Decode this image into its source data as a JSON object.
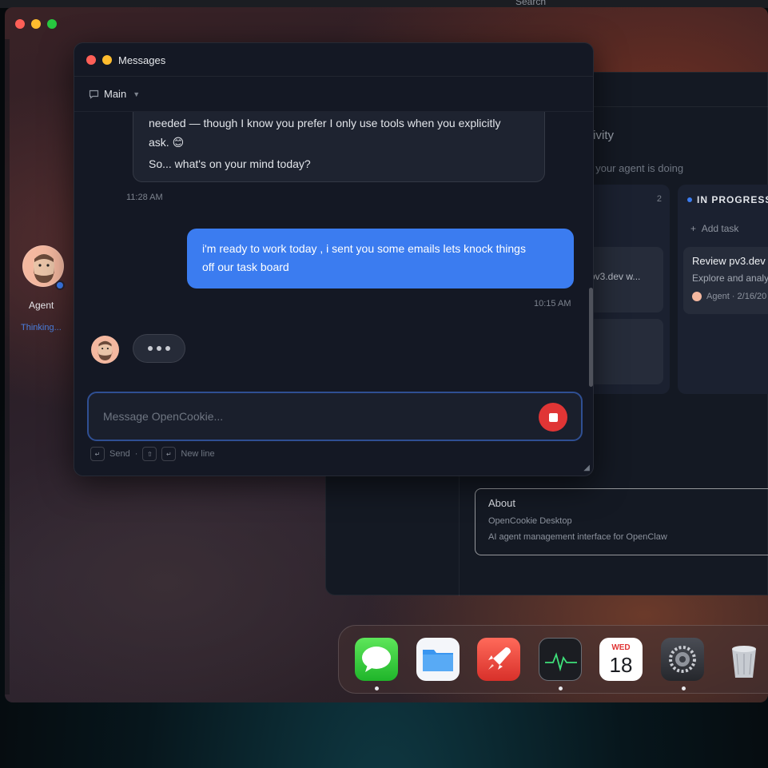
{
  "topbar": {
    "search_label": "Search"
  },
  "sidebar_agent": {
    "name": "Agent",
    "status": "Thinking..."
  },
  "activity_window": {
    "title": "tivity",
    "subtitle": "t your agent is doing",
    "column_count": "2",
    "card_snippet": "pv3.dev w...",
    "in_progress": {
      "label": "IN PROGRESS",
      "add_task": "Add task",
      "task": {
        "title": "Review pv3.dev",
        "description": "Explore and analy",
        "meta": "Agent · 2/16/20"
      }
    },
    "about": {
      "title": "About",
      "line1": "OpenCookie Desktop",
      "line2": "AI agent management interface for OpenClaw"
    }
  },
  "messages_window": {
    "title": "Messages",
    "channel": "Main",
    "agent_message": {
      "line1": "needed — though I know you prefer I only use tools when you explicitly",
      "line2": "ask. 😊",
      "line3": "So... what's on your mind today?",
      "time": "11:28 AM"
    },
    "user_message": {
      "line1": "i'm ready to work today , i sent you some emails lets knock things",
      "line2": "off our task board",
      "time": "10:15 AM"
    },
    "composer": {
      "placeholder": "Message OpenCookie..."
    },
    "hints": {
      "send_key": "↵",
      "send": "Send",
      "sep": "·",
      "shift_key": "⇧",
      "newline_key": "↵",
      "newline": "New line"
    }
  },
  "dock": {
    "calendar": {
      "day": "WED",
      "date": "18"
    },
    "items": [
      "messages-icon",
      "files-icon",
      "rocket-icon",
      "activity-monitor-icon",
      "calendar-icon",
      "settings-icon",
      "trash-icon"
    ]
  }
}
